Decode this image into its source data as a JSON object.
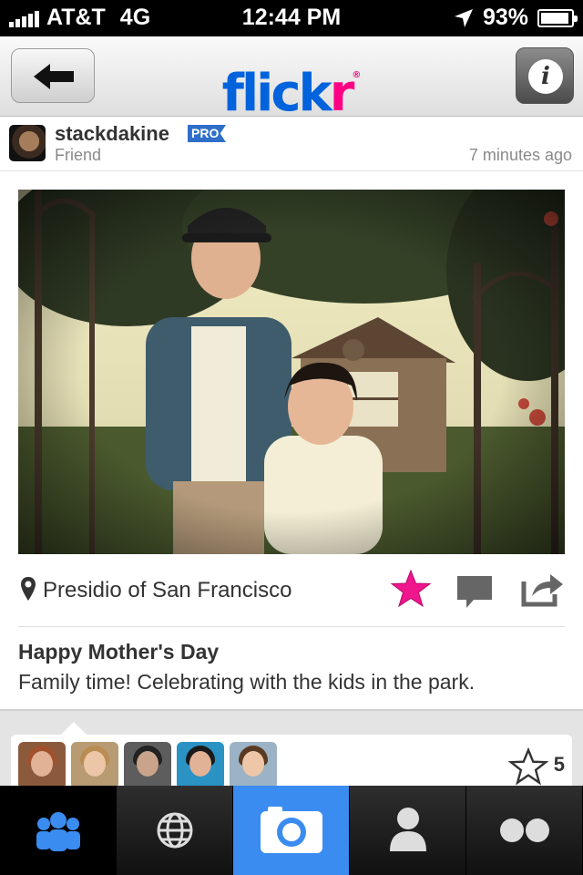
{
  "status_bar": {
    "carrier": "AT&T",
    "network": "4G",
    "time": "12:44 PM",
    "battery_percent": "93%",
    "battery_level": 0.93
  },
  "nav": {
    "logo_blue": "flick",
    "logo_pink": "r",
    "logo_mark": "®",
    "back_icon": "back-arrow-icon",
    "info_label": "i"
  },
  "author": {
    "username": "stackdakine",
    "badge": "PRO",
    "relation": "Friend",
    "posted": "7 minutes ago"
  },
  "photo": {
    "location": "Presidio of San Francisco",
    "title": "Happy Mother's Day",
    "description": "Family time! Celebrating with the kids in the park.",
    "favorited": true
  },
  "faves": {
    "count": "5",
    "avatars": [
      "fave-user-1",
      "fave-user-2",
      "fave-user-3",
      "fave-user-4",
      "fave-user-5"
    ]
  },
  "tabs": [
    {
      "name": "contacts",
      "icon": "people-icon",
      "selected": false
    },
    {
      "name": "explore",
      "icon": "globe-icon",
      "selected": false
    },
    {
      "name": "camera",
      "icon": "camera-icon",
      "selected": true
    },
    {
      "name": "you",
      "icon": "person-icon",
      "selected": false
    },
    {
      "name": "more",
      "icon": "flickr-dots-icon",
      "selected": false
    }
  ],
  "colors": {
    "brand_blue": "#0063dc",
    "brand_pink": "#ff0084",
    "tab_active": "#3a8cf0",
    "favorite_star": "#f0168c"
  }
}
